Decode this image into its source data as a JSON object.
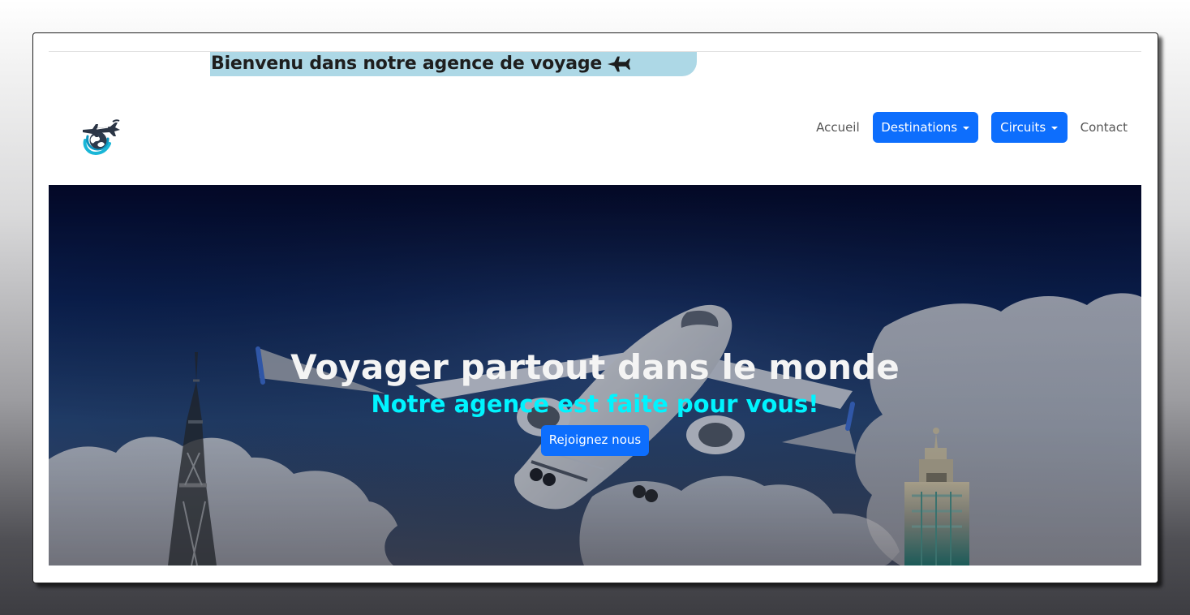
{
  "header": {
    "welcome_text": "Bienvenu dans notre agence de voyage",
    "welcome_icon": "airplane-icon",
    "banner_color": "#add8e6"
  },
  "navbar": {
    "logo_icon": "airplane-globe-logo-icon",
    "items": [
      {
        "label": "Accueil"
      },
      {
        "label": "Destinations",
        "icon": "chevron-down-icon"
      },
      {
        "label": "Circuits",
        "icon": "chevron-down-icon"
      },
      {
        "label": "Contact"
      }
    ]
  },
  "hero": {
    "title": "Voyager partout dans le monde",
    "subtitle": "Notre agence est faite pour vous!",
    "button_label": "Rejoignez nous",
    "subtitle_color": "#00f4ff",
    "button_color": "#0d6efd"
  },
  "colors": {
    "primary": "#0d6efd",
    "card_background": "#ffffff",
    "page_background_top": "#ffffff",
    "page_background_bottom": "#3d3d42"
  }
}
